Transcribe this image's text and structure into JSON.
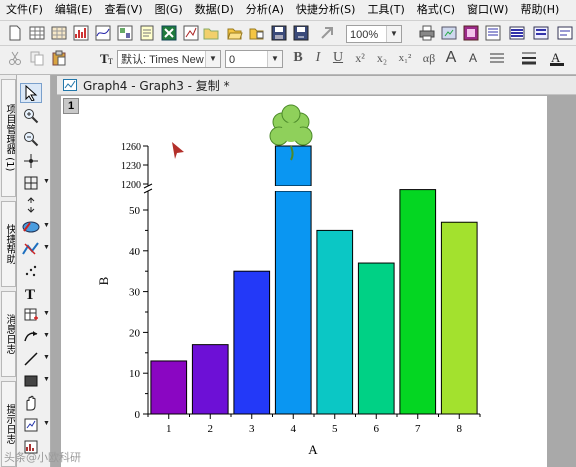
{
  "menubar": {
    "items": [
      "文件(F)",
      "编辑(E)",
      "查看(V)",
      "图(G)",
      "数据(D)",
      "分析(A)",
      "快捷分析(S)",
      "工具(T)",
      "格式(C)",
      "窗口(W)",
      "帮助(H)"
    ]
  },
  "toolbar": {
    "zoom_value": "100%",
    "font_name": "默认: Times New",
    "font_size": "0",
    "format_buttons": [
      "B",
      "I",
      "U",
      "x²",
      "x₂",
      "x₁²",
      "αβ",
      "A",
      "A"
    ]
  },
  "side_tabs": [
    "项目管理器 (1)",
    "快捷帮助",
    "消息日志",
    "提示日志"
  ],
  "graph_window": {
    "title": "Graph4 - Graph3 - 复制 *",
    "layer_label": "1"
  },
  "chart_data": {
    "type": "bar",
    "categories": [
      "1",
      "2",
      "3",
      "4",
      "5",
      "6",
      "7",
      "8"
    ],
    "values": [
      13,
      17,
      35,
      1260,
      45,
      37,
      55,
      47
    ],
    "xlabel": "A",
    "ylabel": "B",
    "broken_axis": {
      "lower_range": [
        0,
        55
      ],
      "upper_range": [
        1200,
        1260
      ]
    },
    "y_ticks_lower": [
      "0",
      "10",
      "20",
      "30",
      "40",
      "50"
    ],
    "y_ticks_upper": [
      "1200",
      "1230",
      "1260"
    ],
    "colors": [
      "#8a06c2",
      "#6d10d6",
      "#2339f8",
      "#0a96f2",
      "#0bc7c5",
      "#00d185",
      "#04d622",
      "#a3e12e"
    ],
    "grid": false,
    "legend": "none",
    "decoration": "shamrock-icon"
  },
  "watermark": "头条@小欧科研"
}
